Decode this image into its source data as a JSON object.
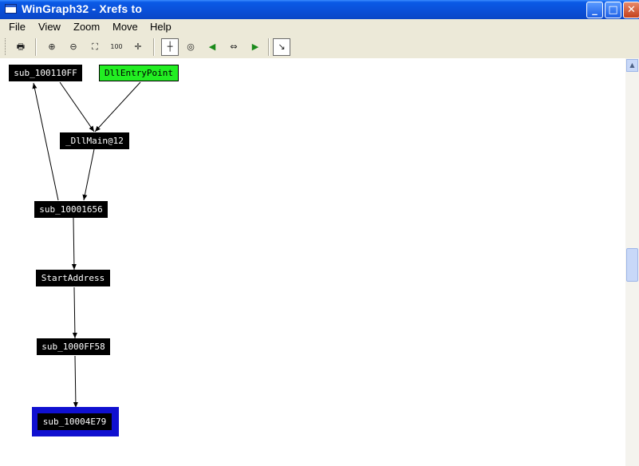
{
  "window": {
    "title": "WinGraph32 - Xrefs to",
    "minimize": "_",
    "maximize": "□",
    "close": "✕"
  },
  "menu": {
    "items": [
      "File",
      "View",
      "Zoom",
      "Move",
      "Help"
    ]
  },
  "toolbar": {
    "buttons": [
      {
        "name": "print-icon",
        "glyph": "🖶"
      },
      {
        "name": "zoom-in-icon",
        "glyph": "⊕"
      },
      {
        "name": "zoom-out-icon",
        "glyph": "⊖"
      },
      {
        "name": "zoom-fit-icon",
        "glyph": "⛶"
      },
      {
        "name": "zoom-100-icon",
        "glyph": "100"
      },
      {
        "name": "center-icon",
        "glyph": "✛"
      },
      {
        "name": "layout-icon",
        "glyph": "┼"
      },
      {
        "name": "reload-icon",
        "glyph": "◎"
      },
      {
        "name": "go-back-icon",
        "glyph": "◀"
      },
      {
        "name": "fit-window-icon",
        "glyph": "⇔"
      },
      {
        "name": "go-forward-icon",
        "glyph": "▶"
      },
      {
        "name": "follow-edge-icon",
        "glyph": "↘"
      }
    ]
  },
  "graph": {
    "nodes": [
      {
        "id": "sub_100110FF",
        "label": "sub_100110FF"
      },
      {
        "id": "DllEntryPoint",
        "label": "DllEntryPoint"
      },
      {
        "id": "_DllMain@12",
        "label": "_DllMain@12"
      },
      {
        "id": "sub_10001656",
        "label": "sub_10001656"
      },
      {
        "id": "StartAddress",
        "label": "StartAddress"
      },
      {
        "id": "sub_1000FF58",
        "label": "sub_1000FF58"
      },
      {
        "id": "sub_10004E79",
        "label": "sub_10004E79"
      }
    ],
    "edges": [
      {
        "from": "sub_100110FF",
        "to": "_DllMain@12"
      },
      {
        "from": "DllEntryPoint",
        "to": "_DllMain@12"
      },
      {
        "from": "_DllMain@12",
        "to": "sub_10001656"
      },
      {
        "from": "sub_10001656",
        "to": "sub_100110FF"
      },
      {
        "from": "sub_10001656",
        "to": "StartAddress"
      },
      {
        "from": "StartAddress",
        "to": "sub_1000FF58"
      },
      {
        "from": "sub_1000FF58",
        "to": "sub_10004E79"
      }
    ],
    "entry_color": "#22ee22",
    "selected_color": "#1010d0",
    "node_color": "#000000"
  }
}
